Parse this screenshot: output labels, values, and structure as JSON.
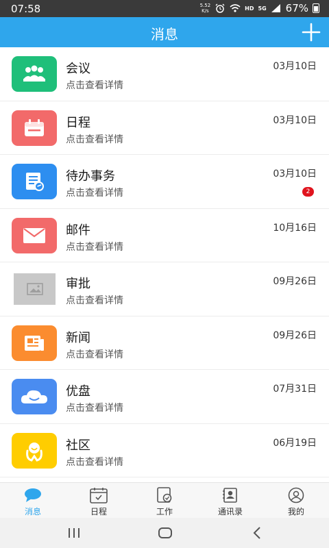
{
  "status": {
    "time": "07:58",
    "speed_top": "5.52",
    "speed_bottom": "K/s",
    "network": "HD",
    "signal": "5G",
    "battery": "67%"
  },
  "header": {
    "title": "消息"
  },
  "items": [
    {
      "name": "会议",
      "sub": "点击查看详情",
      "date": "03月10日",
      "color": "#1fbf7a",
      "icon": "meeting-icon"
    },
    {
      "name": "日程",
      "sub": "点击查看详情",
      "date": "03月10日",
      "color": "#f26a6a",
      "icon": "calendar-icon"
    },
    {
      "name": "待办事务",
      "sub": "点击查看详情",
      "date": "03月10日",
      "color": "#2d8ef0",
      "icon": "todo-icon",
      "badge": "2"
    },
    {
      "name": "邮件",
      "sub": "点击查看详情",
      "date": "10月16日",
      "color": "#f26a6a",
      "icon": "mail-icon"
    },
    {
      "name": "审批",
      "sub": "点击查看详情",
      "date": "09月26日",
      "color": "#c8c8c8",
      "icon": "image-placeholder-icon"
    },
    {
      "name": "新闻",
      "sub": "点击查看详情",
      "date": "09月26日",
      "color": "#fb8c2f",
      "icon": "news-icon"
    },
    {
      "name": "优盘",
      "sub": "点击查看详情",
      "date": "07月31日",
      "color": "#4a8cf0",
      "icon": "cloud-icon"
    },
    {
      "name": "社区",
      "sub": "点击查看详情",
      "date": "06月19日",
      "color": "#ffcd00",
      "icon": "community-icon"
    }
  ],
  "tabs": [
    {
      "label": "消息",
      "icon": "chat-icon",
      "active": true
    },
    {
      "label": "日程",
      "icon": "calendar-icon"
    },
    {
      "label": "工作",
      "icon": "work-icon"
    },
    {
      "label": "通讯录",
      "icon": "contacts-icon"
    },
    {
      "label": "我的",
      "icon": "profile-icon"
    }
  ],
  "colors": {
    "accent": "#2fa6ec",
    "badge": "#e0141e"
  }
}
